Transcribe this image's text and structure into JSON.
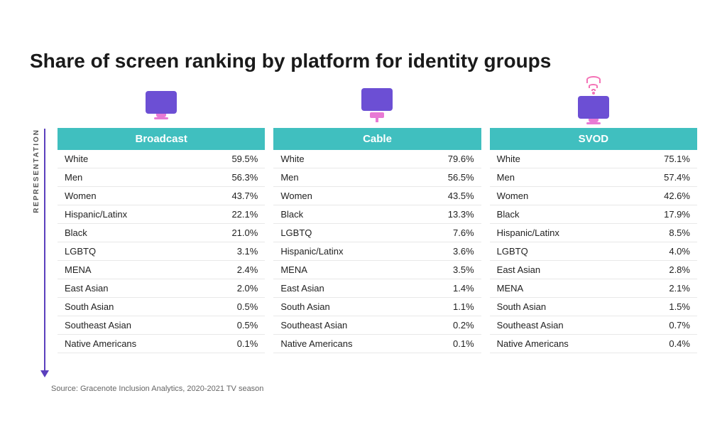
{
  "title": "Share of screen ranking by platform for identity groups",
  "source": "Source: Gracenote Inclusion Analytics, 2020-2021 TV season",
  "yAxisLabel": "REPRESENTATION",
  "platforms": [
    {
      "name": "Broadcast",
      "iconType": "broadcast",
      "rows": [
        {
          "label": "White",
          "value": "59.5%"
        },
        {
          "label": "Men",
          "value": "56.3%"
        },
        {
          "label": "Women",
          "value": "43.7%"
        },
        {
          "label": "Hispanic/Latinx",
          "value": "22.1%"
        },
        {
          "label": "Black",
          "value": "21.0%"
        },
        {
          "label": "LGBTQ",
          "value": "3.1%"
        },
        {
          "label": "MENA",
          "value": "2.4%"
        },
        {
          "label": "East Asian",
          "value": "2.0%"
        },
        {
          "label": "South Asian",
          "value": "0.5%"
        },
        {
          "label": "Southeast Asian",
          "value": "0.5%"
        },
        {
          "label": "Native Americans",
          "value": "0.1%"
        }
      ]
    },
    {
      "name": "Cable",
      "iconType": "cable",
      "rows": [
        {
          "label": "White",
          "value": "79.6%"
        },
        {
          "label": "Men",
          "value": "56.5%"
        },
        {
          "label": "Women",
          "value": "43.5%"
        },
        {
          "label": "Black",
          "value": "13.3%"
        },
        {
          "label": "LGBTQ",
          "value": "7.6%"
        },
        {
          "label": "Hispanic/Latinx",
          "value": "3.6%"
        },
        {
          "label": "MENA",
          "value": "3.5%"
        },
        {
          "label": "East Asian",
          "value": "1.4%"
        },
        {
          "label": "South Asian",
          "value": "1.1%"
        },
        {
          "label": "Southeast Asian",
          "value": "0.2%"
        },
        {
          "label": "Native Americans",
          "value": "0.1%"
        }
      ]
    },
    {
      "name": "SVOD",
      "iconType": "svod",
      "rows": [
        {
          "label": "White",
          "value": "75.1%"
        },
        {
          "label": "Men",
          "value": "57.4%"
        },
        {
          "label": "Women",
          "value": "42.6%"
        },
        {
          "label": "Black",
          "value": "17.9%"
        },
        {
          "label": "Hispanic/Latinx",
          "value": "8.5%"
        },
        {
          "label": "LGBTQ",
          "value": "4.0%"
        },
        {
          "label": "East Asian",
          "value": "2.8%"
        },
        {
          "label": "MENA",
          "value": "2.1%"
        },
        {
          "label": "South Asian",
          "value": "1.5%"
        },
        {
          "label": "Southeast Asian",
          "value": "0.7%"
        },
        {
          "label": "Native Americans",
          "value": "0.4%"
        }
      ]
    }
  ]
}
